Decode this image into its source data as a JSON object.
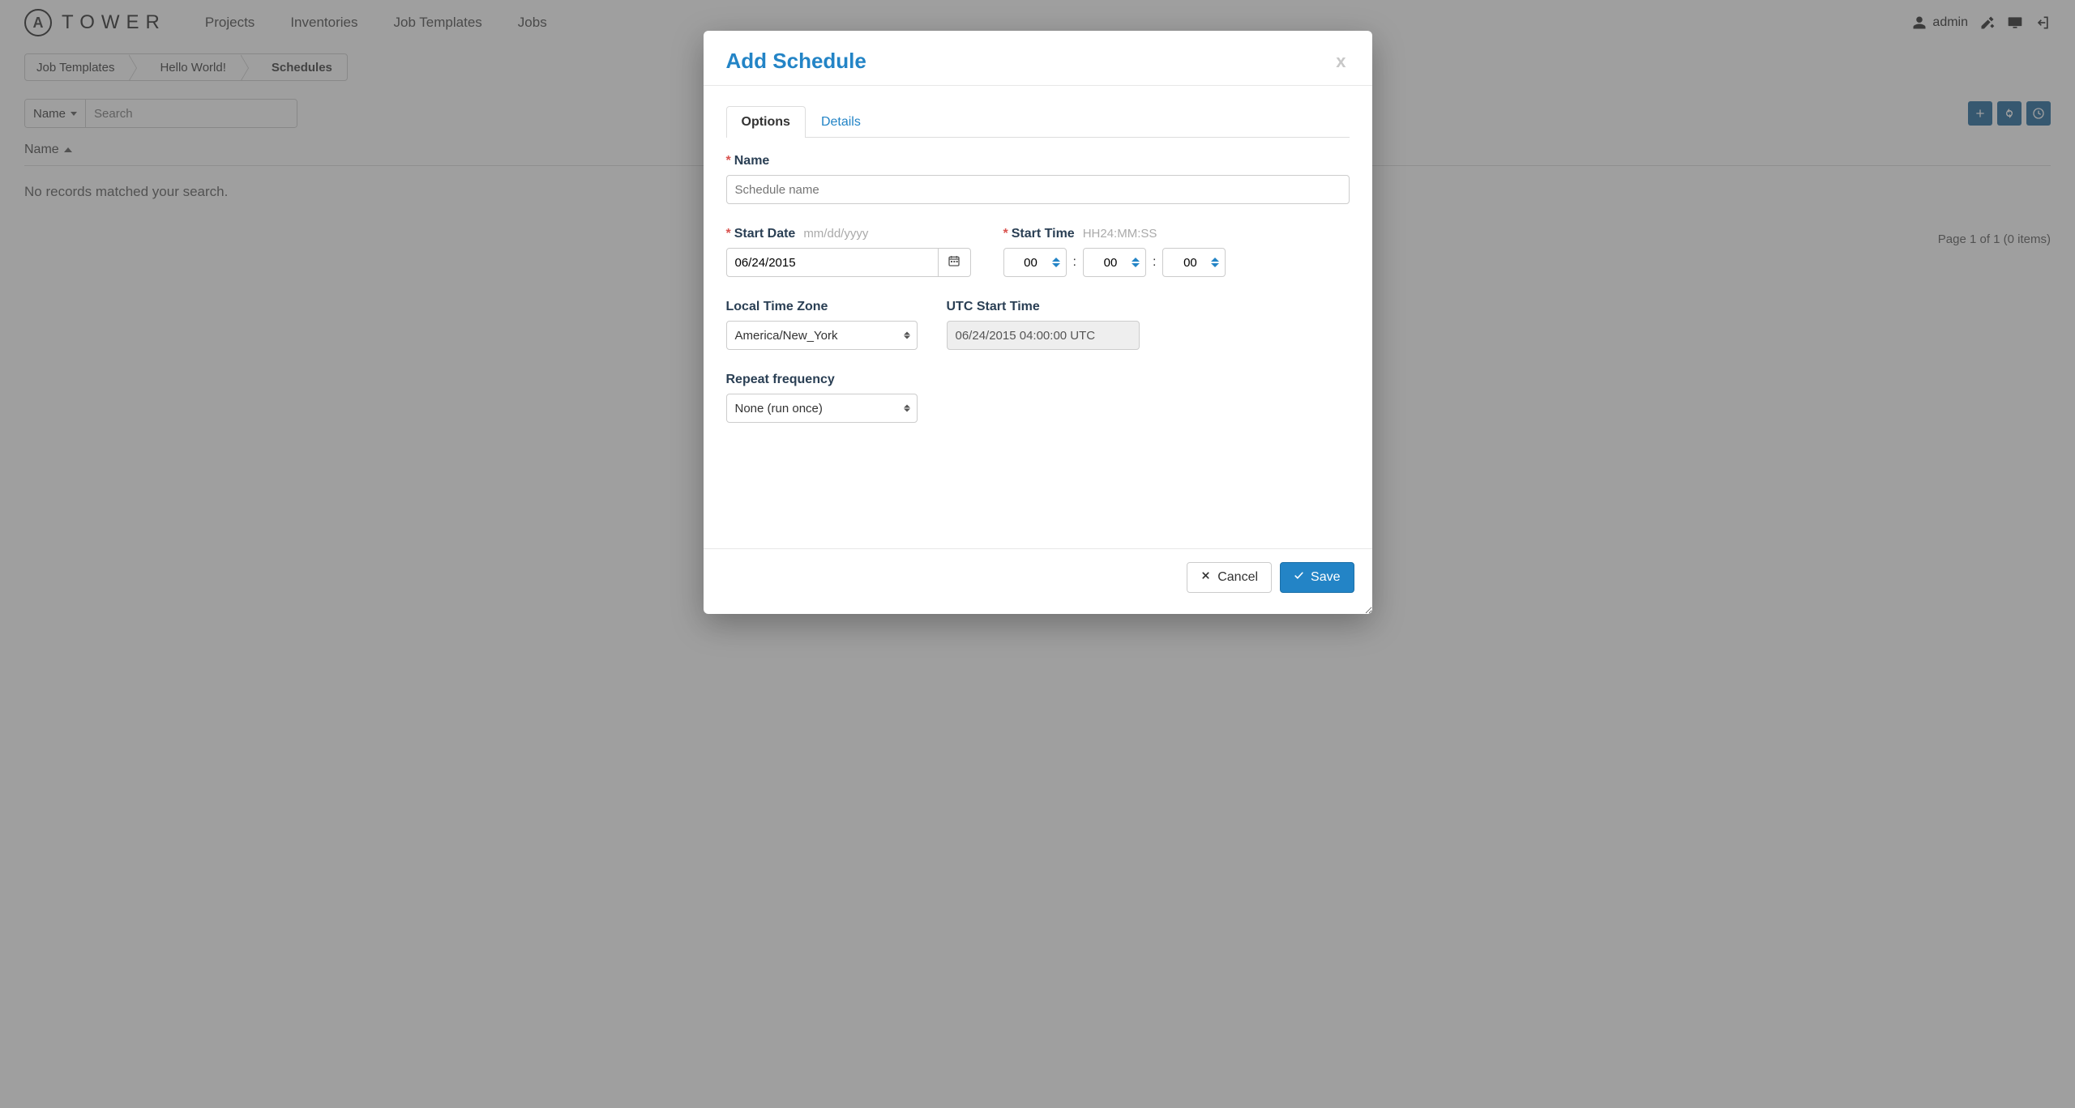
{
  "brand": {
    "badge": "A",
    "name": "TOWER"
  },
  "nav": {
    "projects": "Projects",
    "inventories": "Inventories",
    "job_templates": "Job Templates",
    "jobs": "Jobs"
  },
  "user": {
    "name": "admin"
  },
  "breadcrumbs": {
    "job_templates": "Job Templates",
    "hello_world": "Hello World!",
    "schedules": "Schedules"
  },
  "toolbar": {
    "filter_label": "Name",
    "search_placeholder": "Search"
  },
  "table": {
    "col_name": "Name",
    "empty": "No records matched your search.",
    "pager": "Page 1 of 1 (0 items)"
  },
  "modal": {
    "title": "Add Schedule",
    "tabs": {
      "options": "Options",
      "details": "Details"
    },
    "labels": {
      "name": "Name",
      "start_date": "Start Date",
      "start_date_hint": "mm/dd/yyyy",
      "start_time": "Start Time",
      "start_time_hint": "HH24:MM:SS",
      "local_tz": "Local Time Zone",
      "utc_start": "UTC Start Time",
      "repeat": "Repeat frequency"
    },
    "fields": {
      "name_placeholder": "Schedule name",
      "start_date_value": "06/24/2015",
      "hh": "00",
      "mm": "00",
      "ss": "00",
      "timezone": "America/New_York",
      "utc_value": "06/24/2015 04:00:00 UTC",
      "repeat_value": "None (run once)"
    },
    "buttons": {
      "cancel": "Cancel",
      "save": "Save"
    }
  }
}
